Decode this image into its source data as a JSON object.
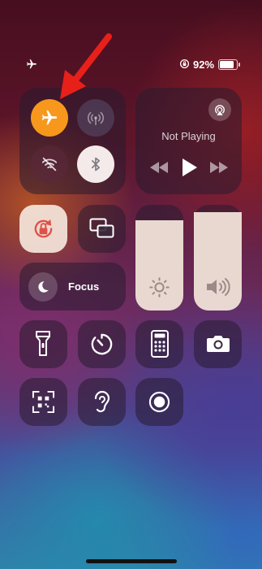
{
  "status_bar": {
    "left_icon": "airplane-icon",
    "battery_percent": "92%",
    "battery_level": 0.92,
    "rotation_lock_icon": "rotation-lock-icon"
  },
  "connectivity": {
    "airplane_mode": {
      "icon": "airplane-icon",
      "state": "on",
      "color": "#F7981D"
    },
    "cellular": {
      "icon": "cellular-antenna-icon",
      "state": "off"
    },
    "wifi": {
      "icon": "wifi-off-icon",
      "state": "off"
    },
    "bluetooth": {
      "icon": "bluetooth-icon",
      "state": "on",
      "color": "#F5EAEA"
    }
  },
  "now_playing": {
    "title": "Not Playing",
    "airplay_icon": "airplay-icon",
    "controls": [
      "rewind-icon",
      "play-icon",
      "fast-forward-icon"
    ]
  },
  "controls": {
    "orientation_lock": {
      "icon": "orientation-lock-icon",
      "state": "on"
    },
    "screen_mirroring": {
      "icon": "screen-mirroring-icon"
    },
    "focus": {
      "label": "Focus",
      "icon": "moon-icon"
    },
    "brightness": {
      "icon": "sun-icon",
      "level": 0.85
    },
    "volume": {
      "icon": "speaker-icon",
      "level": 0.93
    },
    "row_buttons": [
      {
        "icon": "flashlight-icon"
      },
      {
        "icon": "timer-icon"
      },
      {
        "icon": "calculator-icon"
      },
      {
        "icon": "camera-icon"
      },
      {
        "icon": "qr-code-scanner-icon"
      },
      {
        "icon": "hearing-icon"
      },
      {
        "icon": "screen-recording-icon"
      }
    ]
  },
  "annotation": {
    "arrow_color": "#E8201A"
  }
}
